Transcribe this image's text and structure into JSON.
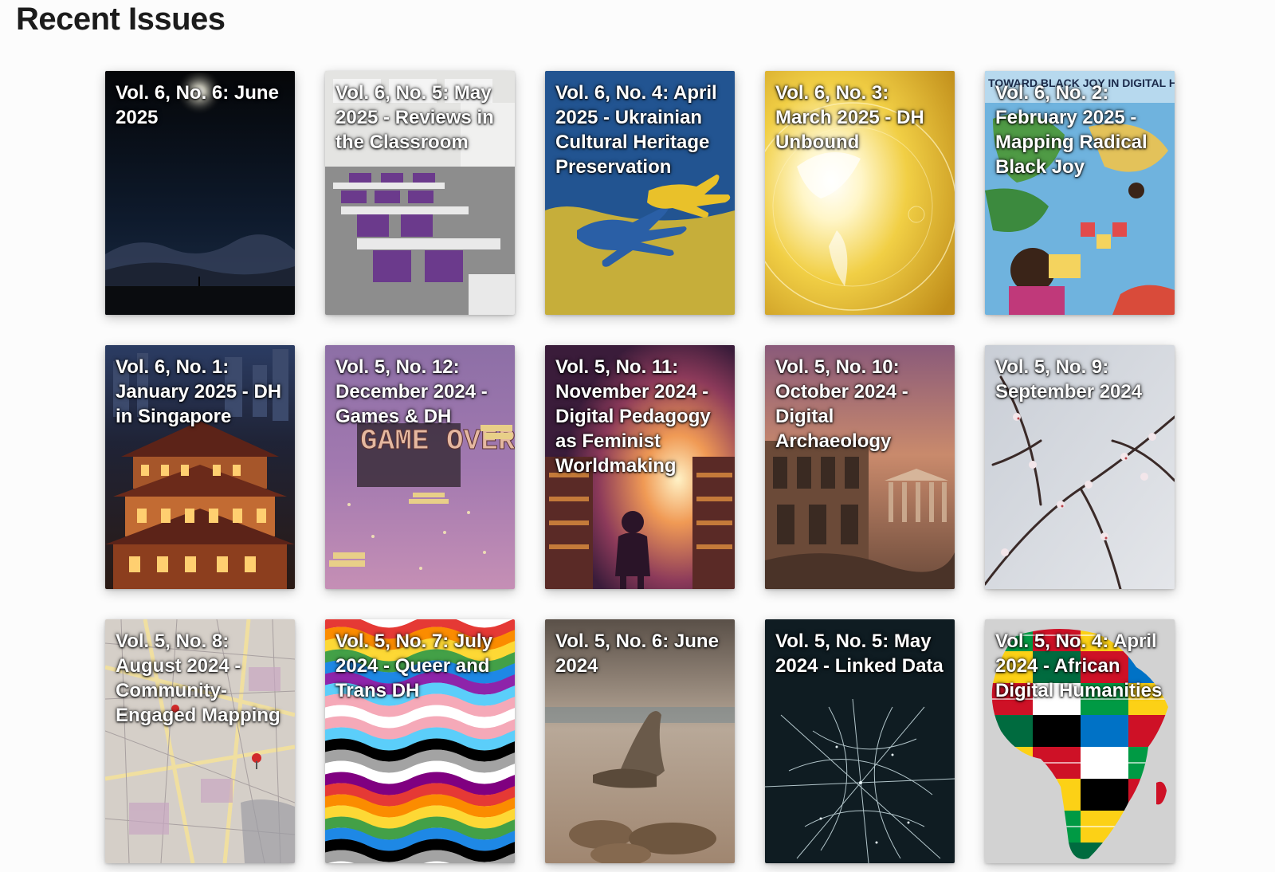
{
  "page": {
    "title": "Recent Issues"
  },
  "issues": [
    {
      "title": "Vol. 6, No. 6: June 2025",
      "cover": "night-sky-mountain"
    },
    {
      "title": "Vol. 6, No. 5: May 2025 - Reviews in the Classroom",
      "cover": "classroom-purple-chairs"
    },
    {
      "title": "Vol. 6, No. 4: April 2025 - Ukrainian Cultural Heritage Preservation",
      "cover": "blue-yellow-hands"
    },
    {
      "title": "Vol. 6, No. 3: March 2025 - DH Unbound",
      "cover": "golden-globe"
    },
    {
      "title": "Vol. 6, No. 2: February 2025 - Mapping Radical Black Joy",
      "cover": "illustrated-map-black-joy",
      "cover_text": "TOWARD BLACK JOY IN DIGITAL HUMANITIES"
    },
    {
      "title": "Vol. 6, No. 1: January 2025 - DH in Singapore",
      "cover": "singapore-temple-night"
    },
    {
      "title": "Vol. 5, No. 12: December 2024 - Games & DH",
      "cover": "pixel-game-over",
      "cover_text": "GAME OVER"
    },
    {
      "title": "Vol. 5, No. 11: November 2024 - Digital Pedagogy as Feminist Worldmaking",
      "cover": "girl-library-light"
    },
    {
      "title": "Vol. 5, No. 10: October 2024 - Digital Archaeology",
      "cover": "ruins-painting"
    },
    {
      "title": "Vol. 5, No. 9: September 2024",
      "cover": "blossom-branches"
    },
    {
      "title": "Vol. 5, No. 8: August 2024 - Community-Engaged Mapping",
      "cover": "city-street-map"
    },
    {
      "title": "Vol. 5, No. 7: July 2024 - Queer and Trans DH",
      "cover": "pride-flag-waves"
    },
    {
      "title": "Vol. 5, No. 6: June 2024",
      "cover": "sea-lions-beach"
    },
    {
      "title": "Vol. 5, No. 5: May 2024 - Linked Data",
      "cover": "spider-web-dark"
    },
    {
      "title": "Vol. 5, No. 4: April 2024 - African Digital Humanities",
      "cover": "africa-flags-map"
    }
  ]
}
